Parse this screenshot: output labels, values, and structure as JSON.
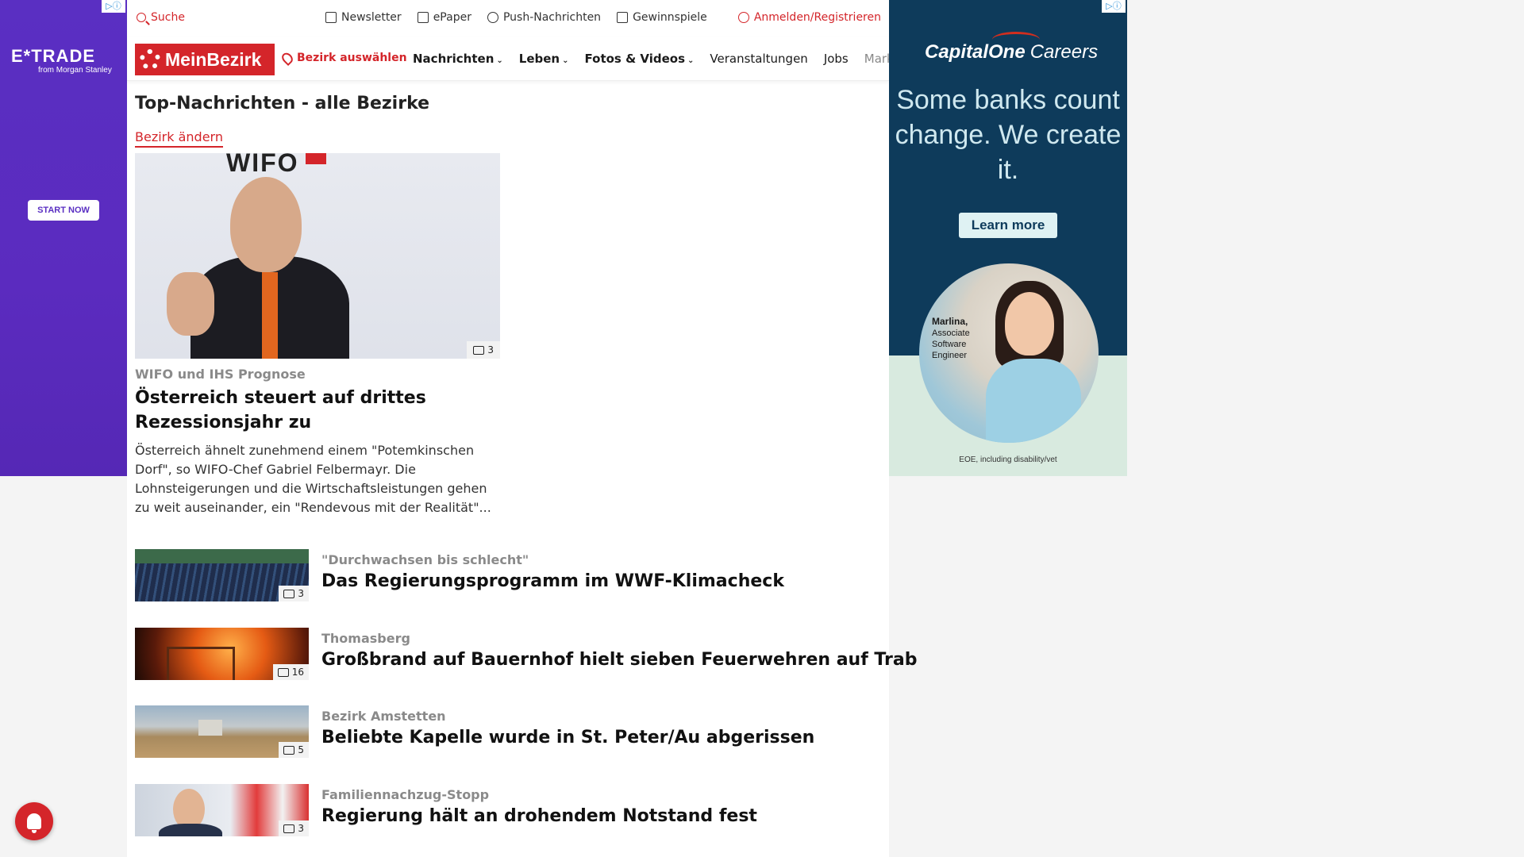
{
  "ads": {
    "left": {
      "brand": "E*TRADE",
      "sub": "from Morgan Stanley",
      "cta": "START NOW"
    },
    "right": {
      "brand": "CapitalOne",
      "brand_suffix": "Careers",
      "headline": "Some banks count change. We create it.",
      "cta": "Learn more",
      "persona_name": "Marlina,",
      "persona_role": "Associate Software Engineer",
      "footer": "EOE, including disability/vet"
    }
  },
  "topbar": {
    "search": "Suche",
    "links": [
      "Newsletter",
      "ePaper",
      "Push-Nachrichten",
      "Gewinnspiele"
    ],
    "login": "Anmelden/Registrieren"
  },
  "navbar": {
    "brand": "MeinBezirk",
    "bezirk": "Bezirk auswählen",
    "items": [
      "Nachrichten",
      "Leben",
      "Fotos & Videos",
      "Veranstaltungen",
      "Jobs",
      "Marktplatz"
    ]
  },
  "page": {
    "title": "Top-Nachrichten - alle Bezirke",
    "change_bezirk": "Bezirk ändern"
  },
  "hero": {
    "image_count": "3",
    "kicker": "WIFO und IHS Prognose",
    "title": "Österreich steuert auf drittes Rezessionsjahr zu",
    "text": "Österreich ähnelt zunehmend einem \"Potemkinschen Dorf\", so WIFO-Chef Gabriel Felbermayr. Die Lohnsteigerungen und die Wirtschaftsleistungen gehen zu weit auseinander, ein \"Rendevous mit der Realität\"..."
  },
  "teasers": [
    {
      "kicker": "\"Durchwachsen bis schlecht\"",
      "title": "Das Regierungsprogramm im WWF-Klimacheck",
      "image_count": "3"
    },
    {
      "kicker": "Thomasberg",
      "title": "Großbrand auf Bauernhof hielt sieben Feuerwehren auf Trab",
      "image_count": "16"
    },
    {
      "kicker": "Bezirk Amstetten",
      "title": "Beliebte Kapelle wurde in St. Peter/Au abgerissen",
      "image_count": "5"
    },
    {
      "kicker": "Familiennachzug-Stopp",
      "title": "Regierung hält an drohendem Notstand fest",
      "image_count": "3"
    }
  ],
  "colors": {
    "brand_red": "#d4252a",
    "etrade_purple": "#5a2fc2",
    "capitalone_navy": "#0e3b5b"
  }
}
